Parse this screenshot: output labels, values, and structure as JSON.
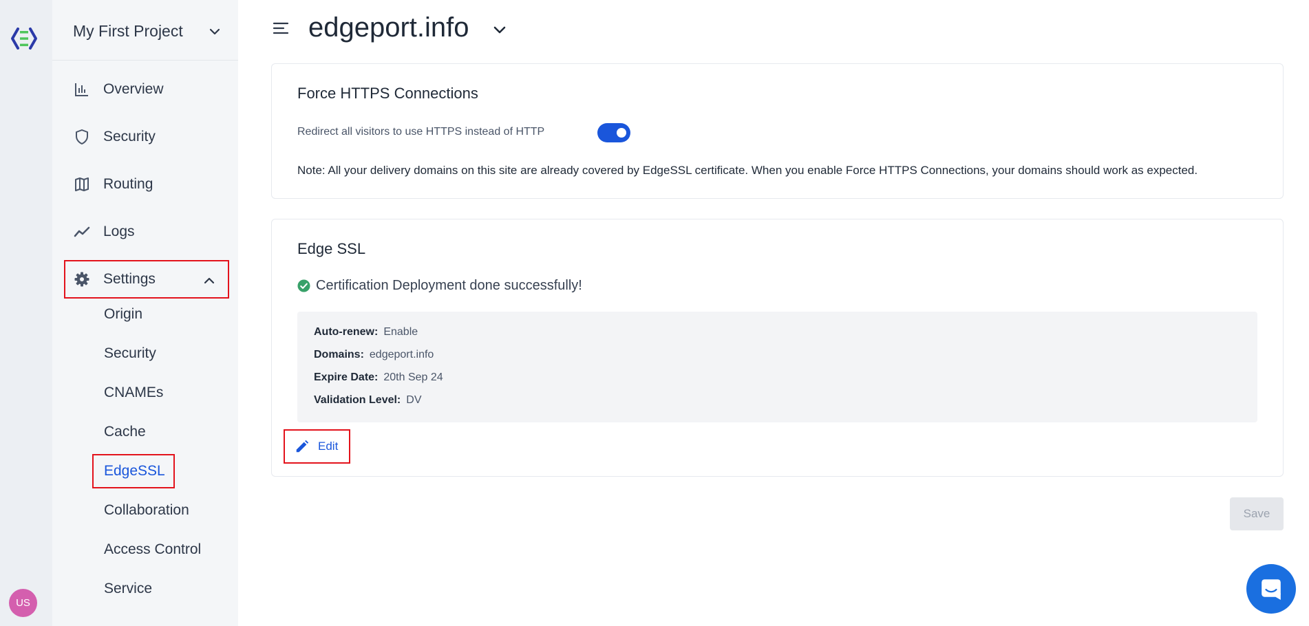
{
  "project": {
    "name": "My First Project"
  },
  "user": {
    "initials": "US"
  },
  "nav": {
    "items": [
      {
        "label": "Overview",
        "icon": "bar-chart-icon"
      },
      {
        "label": "Security",
        "icon": "shield-icon"
      },
      {
        "label": "Routing",
        "icon": "map-icon"
      },
      {
        "label": "Logs",
        "icon": "trend-line-icon"
      },
      {
        "label": "Settings",
        "icon": "gear-icon"
      }
    ],
    "settings_sub": [
      {
        "label": "Origin"
      },
      {
        "label": "Security"
      },
      {
        "label": "CNAMEs"
      },
      {
        "label": "Cache"
      },
      {
        "label": "EdgeSSL",
        "active": true
      },
      {
        "label": "Collaboration"
      },
      {
        "label": "Access Control"
      },
      {
        "label": "Service"
      }
    ]
  },
  "header": {
    "domain": "edgeport.info"
  },
  "https_card": {
    "title": "Force HTTPS Connections",
    "redirect_label": "Redirect all visitors to use HTTPS instead of HTTP",
    "toggle_on": true,
    "note": "Note: All your delivery domains on this site are already covered by EdgeSSL certificate. When you enable Force HTTPS Connections, your domains should work as expected."
  },
  "ssl_card": {
    "title": "Edge SSL",
    "status": "Certification Deployment done successfully!",
    "details": [
      {
        "label": "Auto-renew:",
        "value": "Enable"
      },
      {
        "label": "Domains:",
        "value": "edgeport.info"
      },
      {
        "label": "Expire Date:",
        "value": "20th Sep 24"
      },
      {
        "label": "Validation Level:",
        "value": "DV"
      }
    ],
    "edit_label": "Edit"
  },
  "save_label": "Save",
  "colors": {
    "accent": "#1a56db",
    "highlight": "#e3121b",
    "success": "#38a169"
  }
}
